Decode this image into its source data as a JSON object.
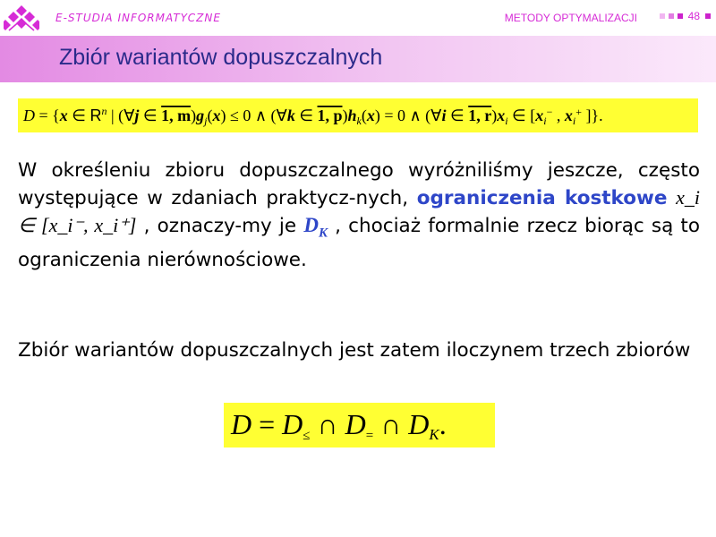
{
  "header": {
    "brand": "E-STUDIA INFORMATYCZNE",
    "course": "METODY OPTYMALIZACJI",
    "page": "48"
  },
  "title": "Zbiór wariantów dopuszczalnych",
  "definition_formula": {
    "set": "D",
    "vector": "x",
    "space": "R",
    "space_exp": "n",
    "forall1_var": "j",
    "forall1_range": "1, m",
    "ineq_fn": "g",
    "ineq_sub": "j",
    "forall2_var": "k",
    "forall2_range": "1, p",
    "eq_fn": "h",
    "eq_sub": "k",
    "forall3_var": "i",
    "forall3_range": "1, r",
    "bound_var": "x",
    "bound_sub": "i"
  },
  "paragraph1": {
    "part1": "W określeniu zbioru dopuszczalnego wyróżniliśmy jeszcze, często występujące w zdaniach praktycz-nych,",
    "highlight": "ograniczenia kostkowe",
    "formula": "x_i ∈ [x_i⁻, x_i⁺]",
    "part2": ", oznaczy-my je",
    "dk_symbol": "D",
    "dk_sub": "K",
    "part3": ", chociaż formalnie rzecz biorąc są to ograniczenia nierównościowe."
  },
  "paragraph2": "Zbiór wariantów dopuszczalnych jest zatem iloczynem trzech zbiorów",
  "result_formula": {
    "lhs": "D",
    "term1_sub": "≤",
    "term2_sub": "=",
    "term3_sub": "K"
  },
  "colors": {
    "accent": "#d62bd6",
    "title": "#2a2a8a",
    "highlight": "#2e46c8",
    "formula_bg": "#ffff33",
    "titlebar_start": "#e38ae3",
    "titlebar_end": "#fbe9fb"
  },
  "icons": [
    "logo-icon"
  ]
}
